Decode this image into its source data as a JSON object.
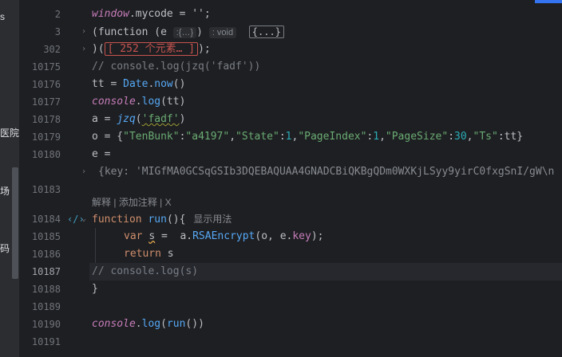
{
  "left_panel": {
    "fragments": [
      "s",
      "医院",
      "场",
      "码"
    ]
  },
  "lines": [
    {
      "no": "2"
    },
    {
      "no": "3"
    },
    {
      "no": "302"
    },
    {
      "no": "10175"
    },
    {
      "no": "10176"
    },
    {
      "no": "10177"
    },
    {
      "no": "10178"
    },
    {
      "no": "10179"
    },
    {
      "no": "10180"
    },
    {
      "no": "10183"
    },
    {
      "no": "10184"
    },
    {
      "no": "10185"
    },
    {
      "no": "10186"
    },
    {
      "no": "10187"
    },
    {
      "no": "10188"
    },
    {
      "no": "10189"
    },
    {
      "no": "10190"
    },
    {
      "no": "10191"
    }
  ],
  "code": {
    "l2_window": "window",
    "l2_rest": ".mycode = '';",
    "l3_open": "(function (e",
    "l3_param_hint": ":{…}",
    "l3_close": ")",
    "l3_return_hint": ": void",
    "l3_fold": "{...}",
    "l302_open": ")(",
    "l302_fold": "[ 252 个元素… ]",
    "l302_close": ");",
    "l10175": "// console.log(jzq('fadf'))",
    "l10176_a": "tt = ",
    "l10176_date": "Date",
    "l10176_dot": ".",
    "l10176_now": "now",
    "l10176_b": "()",
    "l10177_console": "console",
    "l10177_dot": ".",
    "l10177_log": "log",
    "l10177_args": "(tt)",
    "l10178_a": "a = ",
    "l10178_fn": "jzq",
    "l10178_p1": "(",
    "l10178_str": "'fadf'",
    "l10178_p2": ")",
    "l10179_a": "o = {",
    "l10179_k1": "\"TenBunk\"",
    "l10179_c1": ":",
    "l10179_v1": "\"a4197\"",
    "l10179_s1": ",",
    "l10179_k2": "\"State\"",
    "l10179_c2": ":",
    "l10179_v2": "1",
    "l10179_s2": ",",
    "l10179_k3": "\"PageIndex\"",
    "l10179_c3": ":",
    "l10179_v3": "1",
    "l10179_s3": ",",
    "l10179_k4": "\"PageSize\"",
    "l10179_c4": ":",
    "l10179_v4": "30",
    "l10179_s4": ",",
    "l10179_k5": "\"Ts\"",
    "l10179_c5": ":tt}",
    "l10180": "e =",
    "l_key": "{key: 'MIGfMA0GCSqGSIb3DQEBAQUAA4GNADCBiQKBgQDm0WXKjLSyy9yirC0fxgSnI/gW\\n",
    "annot_explain": "解释",
    "annot_sep1": " | ",
    "annot_add": "添加注释",
    "annot_sep2": " | ",
    "annot_x": "X",
    "l10184_kw": "function",
    "l10184_sp": " ",
    "l10184_fn": "run",
    "l10184_rest": "(){",
    "l10184_usage": "显示用法",
    "l10185_kw": "var",
    "l10185_s": "s",
    "l10185_eq": " =  a.",
    "l10185_fn": "RSAEncrypt",
    "l10185_args_a": "(o, e.",
    "l10185_key": "key",
    "l10185_args_b": ");",
    "l10186_kw": "return",
    "l10186_s": " s",
    "l10187": "// console.log(s)",
    "l10188": "}",
    "l10190_console": "console",
    "l10190_dot": ".",
    "l10190_log": "log",
    "l10190_p1": "(",
    "l10190_run": "run",
    "l10190_p2": "())"
  }
}
